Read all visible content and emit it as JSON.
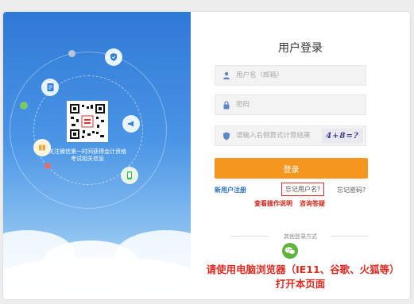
{
  "login": {
    "title": "用户登录",
    "username_placeholder": "用户名（邮箱）",
    "password_placeholder": "密码",
    "captcha_placeholder": "请输入右侧算式计算结果",
    "captcha_text": "4+8=?",
    "submit_label": "登录",
    "register_link": "新用户注册",
    "forgot_username_link": "忘记用户名?",
    "forgot_password_link": "忘记密码?",
    "guide_link": "查看操作说明",
    "faq_link": "咨询答疑",
    "other_login_label": "其他登录方式",
    "browser_notice": "请使用电脑浏览器（IE11、谷歌、火狐等）打开本页面"
  },
  "promo": {
    "qr_caption": "关注微信第一时间获得会计资格考试相关信息"
  },
  "colors": {
    "primary_button": "#f5961f",
    "link_blue": "#2770c2",
    "notice_red": "#e02a20",
    "wechat_green": "#5fb43b"
  }
}
